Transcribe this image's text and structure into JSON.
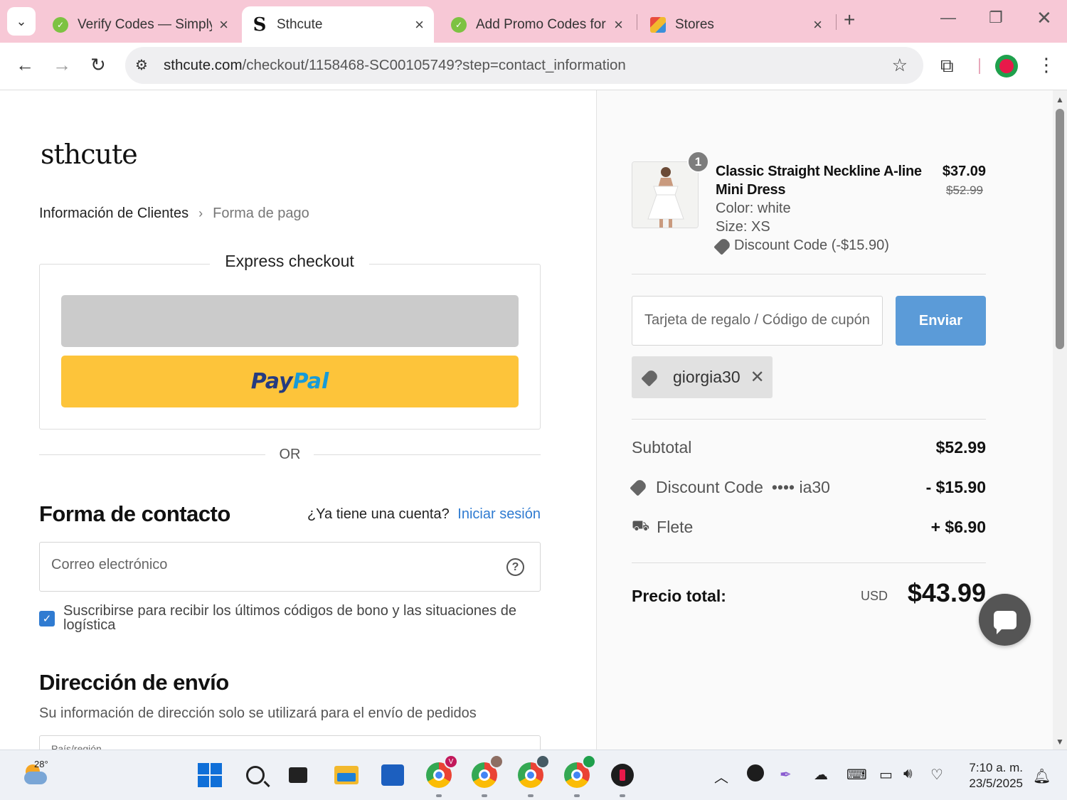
{
  "browser": {
    "tabs": [
      {
        "title": "Verify Codes — Simply",
        "favicon": "verify-codes-favicon",
        "active": false
      },
      {
        "title": "Sthcute",
        "favicon": "sthcute-favicon",
        "active": true
      },
      {
        "title": "Add Promo Codes for",
        "favicon": "verify-codes-favicon",
        "active": false
      },
      {
        "title": "Stores",
        "favicon": "stores-favicon",
        "active": false
      }
    ],
    "url_host": "sthcute.com",
    "url_path": "/checkout/1158468-SC00105749?step=contact_information",
    "accent_color": "#f7c8d6"
  },
  "page": {
    "logo": "sthcute",
    "breadcrumb": {
      "step1": "Información de Clientes",
      "step2": "Forma de pago"
    },
    "express_checkout": {
      "title": "Express checkout",
      "paypal_pay": "Pay",
      "paypal_pal": "Pal"
    },
    "or_text": "OR",
    "contact": {
      "title": "Forma de contacto",
      "has_account": "¿Ya tiene una cuenta?",
      "login_link": "Iniciar sesión",
      "email_placeholder": "Correo electrónico",
      "subscribe_label": "Suscribirse para recibir los últimos códigos de bono y las situaciones de logística",
      "subscribe_checked": true
    },
    "shipping": {
      "title": "Dirección de envío",
      "subtitle": "Su información de dirección solo se utilizará para el envío de pedidos",
      "country_label": "País/región"
    }
  },
  "order": {
    "product": {
      "quantity": "1",
      "name": "Classic Straight Neckline A-line Mini Dress",
      "color": "Color: white",
      "size": "Size: XS",
      "discount": "Discount Code (-$15.90)",
      "price": "$37.09",
      "original_price": "$52.99"
    },
    "coupon": {
      "placeholder": "Tarjeta de regalo / Código de cupón",
      "submit_label": "Enviar",
      "applied_code": "giorgia30"
    },
    "summary": {
      "subtotal_label": "Subtotal",
      "subtotal_value": "$52.99",
      "discount_label": "Discount Code",
      "discount_masked": "•••• ia30",
      "discount_value": "- $15.90",
      "shipping_label": "Flete",
      "shipping_value": "+ $6.90",
      "total_label": "Precio total:",
      "total_currency": "USD",
      "total_value": "$43.99"
    },
    "submit_color": "#5b9bd8"
  },
  "taskbar": {
    "weather_temp": "28°",
    "time": "7:10 a. m.",
    "date": "23/5/2025"
  }
}
